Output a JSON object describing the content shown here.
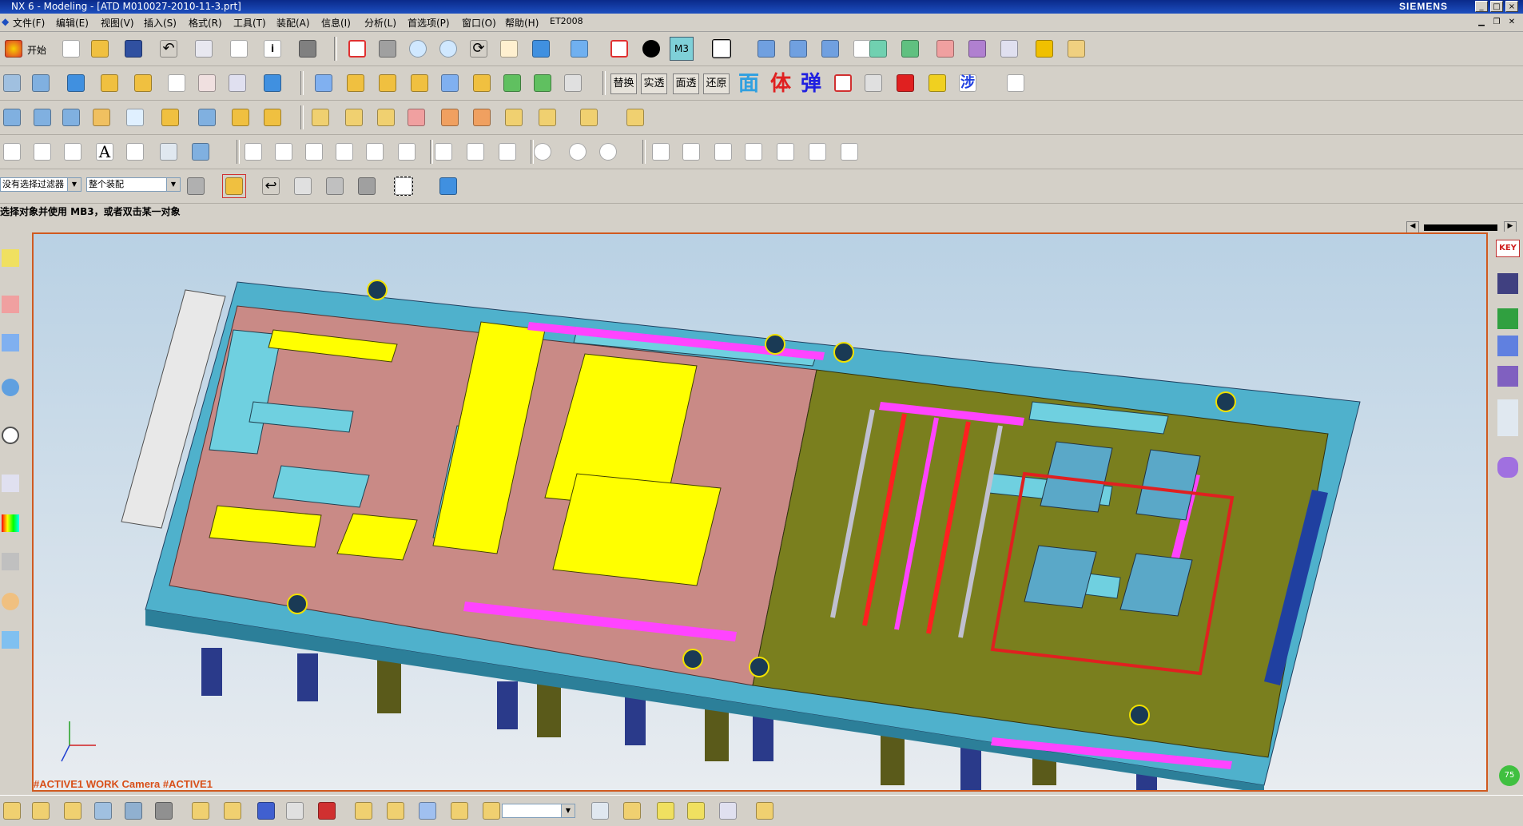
{
  "window": {
    "title": "NX 6 - Modeling - [ATD M010027-2010-11-3.prt]",
    "brand": "SIEMENS",
    "controls": [
      "_",
      "□",
      "×"
    ]
  },
  "menu": {
    "items": [
      "文件(F)",
      "编辑(E)",
      "视图(V)",
      "插入(S)",
      "格式(R)",
      "工具(T)",
      "装配(A)",
      "信息(I)",
      "分析(L)",
      "首选项(P)",
      "窗口(O)",
      "帮助(H)",
      "ET2008"
    ]
  },
  "toolbar": {
    "start_label": "开始",
    "layer_label": "M3",
    "text_buttons": [
      "替换",
      "实透",
      "面透",
      "还原"
    ],
    "cjk_icons": [
      "面",
      "体",
      "弹"
    ]
  },
  "filter": {
    "type_filter": "没有选择过滤器",
    "scope": "整个装配"
  },
  "cue": {
    "message": "选择对象并使用 MB3，或者双击某一对象"
  },
  "viewport": {
    "status_text": "#ACTIVE1 WORK Camera #ACTIVE1",
    "background_top": "#b9d1e4",
    "background_bottom": "#e8ecf0",
    "border_color": "#d05a20"
  },
  "right_resources": {
    "key_label": "KEY",
    "badge": "75"
  },
  "colors": {
    "mold_pink": "#c98a86",
    "mold_yellow": "#ffff00",
    "mold_olive": "#7a7f1e",
    "mold_cyan": "#6fd0e0",
    "mold_magenta": "#ff44ff",
    "base_plate": "#4fb1cc"
  }
}
